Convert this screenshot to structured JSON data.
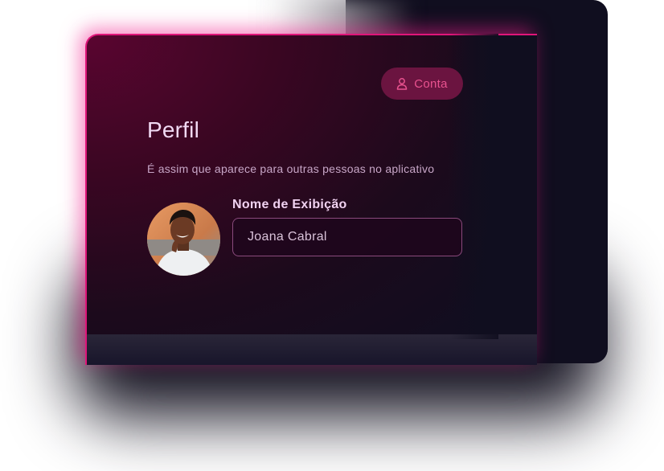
{
  "header": {
    "account_button_label": "Conta",
    "account_icon": "user-icon"
  },
  "profile": {
    "title": "Perfil",
    "subtitle": "É assim que aparece para outras pessoas no aplicativo",
    "display_name_label": "Nome de Exibição",
    "display_name_value": "Joana Cabral"
  },
  "colors": {
    "accent": "#e0157a",
    "button_bg": "#6b1440",
    "button_text": "#e8528f",
    "panel_bg": "#100e1f"
  }
}
